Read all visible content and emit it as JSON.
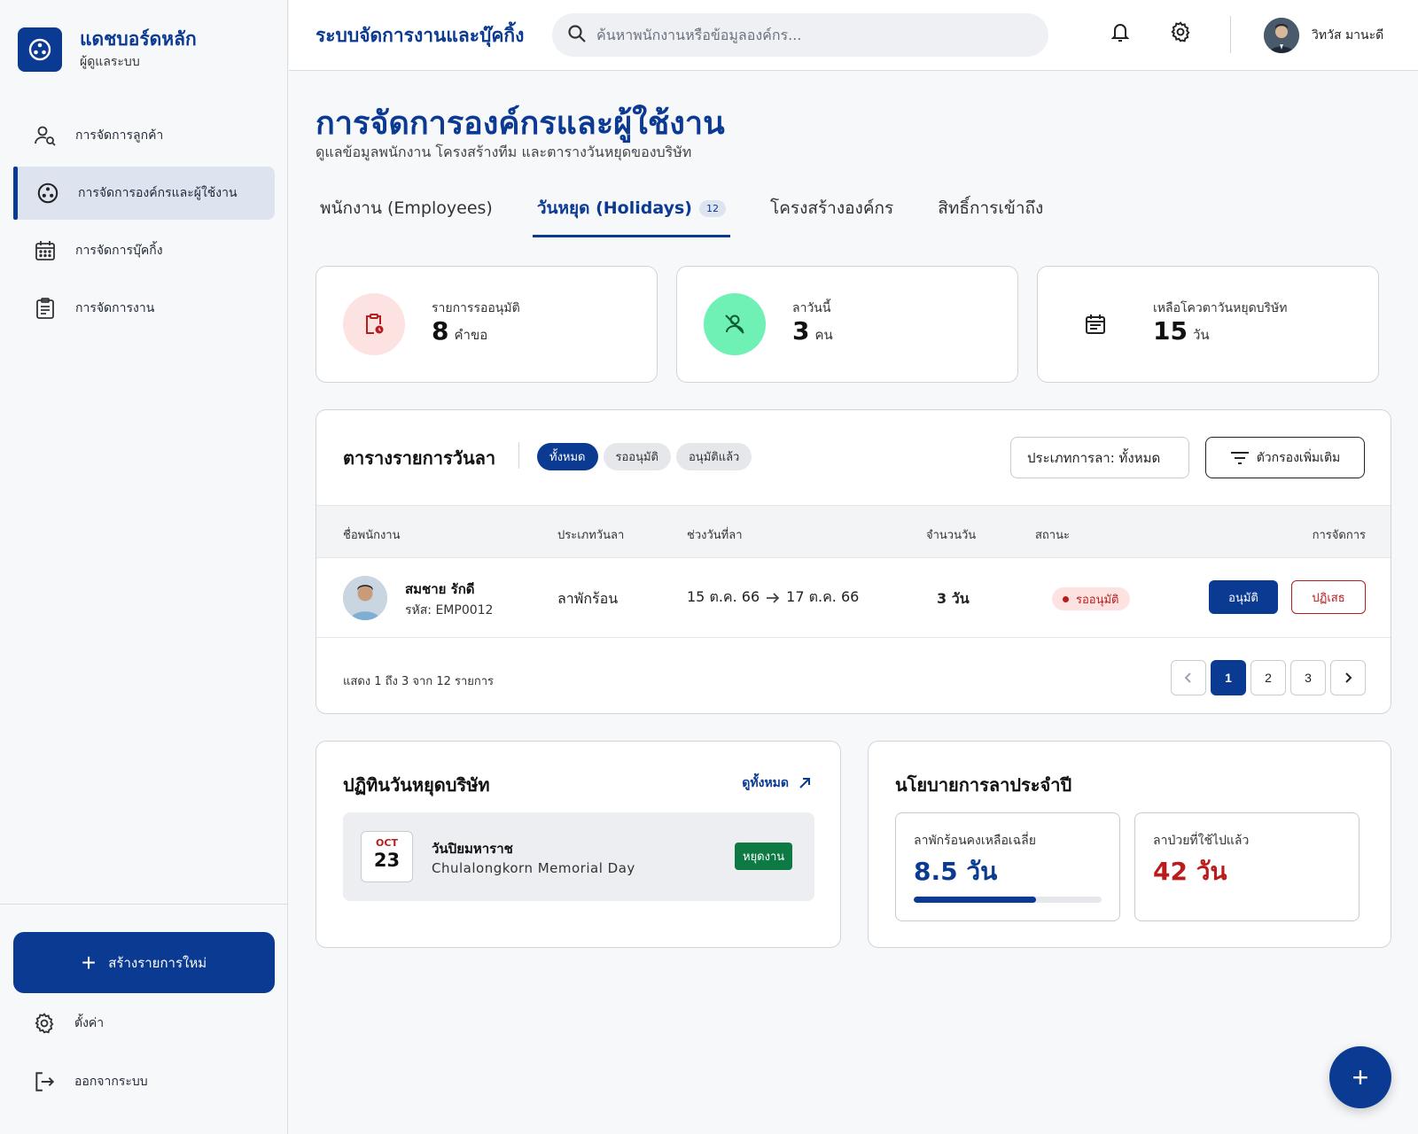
{
  "brand": {
    "title": "แดชบอร์ดหลัก",
    "subtitle": "ผู้ดูแลระบบ",
    "logo_icon": "hub-icon"
  },
  "sidebar": {
    "items": [
      {
        "label": "การจัดการลูกค้า",
        "icon": "user-search-icon",
        "active": false
      },
      {
        "label": "การจัดการองค์กรและผู้ใช้งาน",
        "icon": "hub-icon",
        "active": true
      },
      {
        "label": "การจัดการบุ๊คกิ้ง",
        "icon": "calendar-icon",
        "active": false
      },
      {
        "label": "การจัดการงาน",
        "icon": "clipboard-icon",
        "active": false
      }
    ],
    "create_label": "สร้างรายการใหม่",
    "settings_label": "ตั้งค่า",
    "logout_label": "ออกจากระบบ"
  },
  "header": {
    "app_title": "ระบบจัดการงานและบุ๊คกิ้ง",
    "search_placeholder": "ค้นหาพนักงานหรือข้อมูลองค์กร...",
    "user_name": "วิทวัส มานะดี"
  },
  "page": {
    "title": "การจัดการองค์กรและผู้ใช้งาน",
    "subtitle": "ดูแลข้อมูลพนักงาน โครงสร้างทีม และตารางวันหยุดของบริษัท"
  },
  "tabs": [
    {
      "label": "พนักงาน (Employees)",
      "active": false
    },
    {
      "label": "วันหยุด (Holidays)",
      "active": true,
      "badge": "12"
    },
    {
      "label": "โครงสร้างองค์กร",
      "active": false
    },
    {
      "label": "สิทธิ์การเข้าถึง",
      "active": false
    }
  ],
  "stats": [
    {
      "label": "รายการรออนุมัติ",
      "value": "8",
      "unit": "คำขอ",
      "icon": "pending-clipboard-icon",
      "color": "#fde2e2",
      "icon_color": "#b91c1c"
    },
    {
      "label": "ลาวันนี้",
      "value": "3",
      "unit": "คน",
      "icon": "person-off-icon",
      "color": "#6ff0b5",
      "icon_color": "#0d5c36"
    },
    {
      "label": "เหลือโควตาวันหยุดบริษัท",
      "value": "15",
      "unit": "วัน",
      "icon": "calendar-list-icon",
      "color": "#ffffff",
      "icon_color": "#222222"
    }
  ],
  "leave_table": {
    "title": "ตารางรายการวันลา",
    "chips": [
      {
        "label": "ทั้งหมด",
        "active": true
      },
      {
        "label": "รออนุมัติ",
        "active": false
      },
      {
        "label": "อนุมัติแล้ว",
        "active": false
      }
    ],
    "type_select": "ประเภทการลา: ทั้งหมด",
    "filter_label": "ตัวกรองเพิ่มเติม",
    "columns": [
      "ชื่อพนักงาน",
      "ประเภทวันลา",
      "ช่วงวันที่ลา",
      "จำนวนวัน",
      "สถานะ",
      "การจัดการ"
    ],
    "rows": [
      {
        "name": "สมชาย รักดี",
        "id": "รหัส: EMP0012",
        "type": "ลาพักร้อน",
        "from": "15 ต.ค. 66",
        "to": "17 ต.ค. 66",
        "days": "3 วัน",
        "status": "รออนุมัติ",
        "approve": "อนุมัติ",
        "reject": "ปฏิเสธ"
      }
    ],
    "pager_text": "แสดง 1 ถึง 3 จาก 12 รายการ",
    "pages": [
      "1",
      "2",
      "3"
    ],
    "current_page": "1"
  },
  "holiday_calendar": {
    "title": "ปฏิทินวันหยุดบริษัท",
    "view_all": "ดูทั้งหมด",
    "items": [
      {
        "month": "OCT",
        "day": "23",
        "name": "วันปิยมหาราช",
        "name_en": "Chulalongkorn Memorial Day",
        "badge": "หยุดงาน"
      }
    ]
  },
  "policy": {
    "title": "นโยบายการลาประจำปี",
    "boxes": [
      {
        "label": "ลาพักร้อนคงเหลือเฉลี่ย",
        "value": "8.5 วัน",
        "color": "#0b3a93",
        "progress": 0.65
      },
      {
        "label": "ลาป่วยที่ใช้ไปแล้ว",
        "value": "42 วัน",
        "color": "#b91c1c"
      }
    ]
  },
  "colors": {
    "primary": "#0b3a93",
    "danger": "#b91c1c",
    "success": "#0d7a43"
  }
}
